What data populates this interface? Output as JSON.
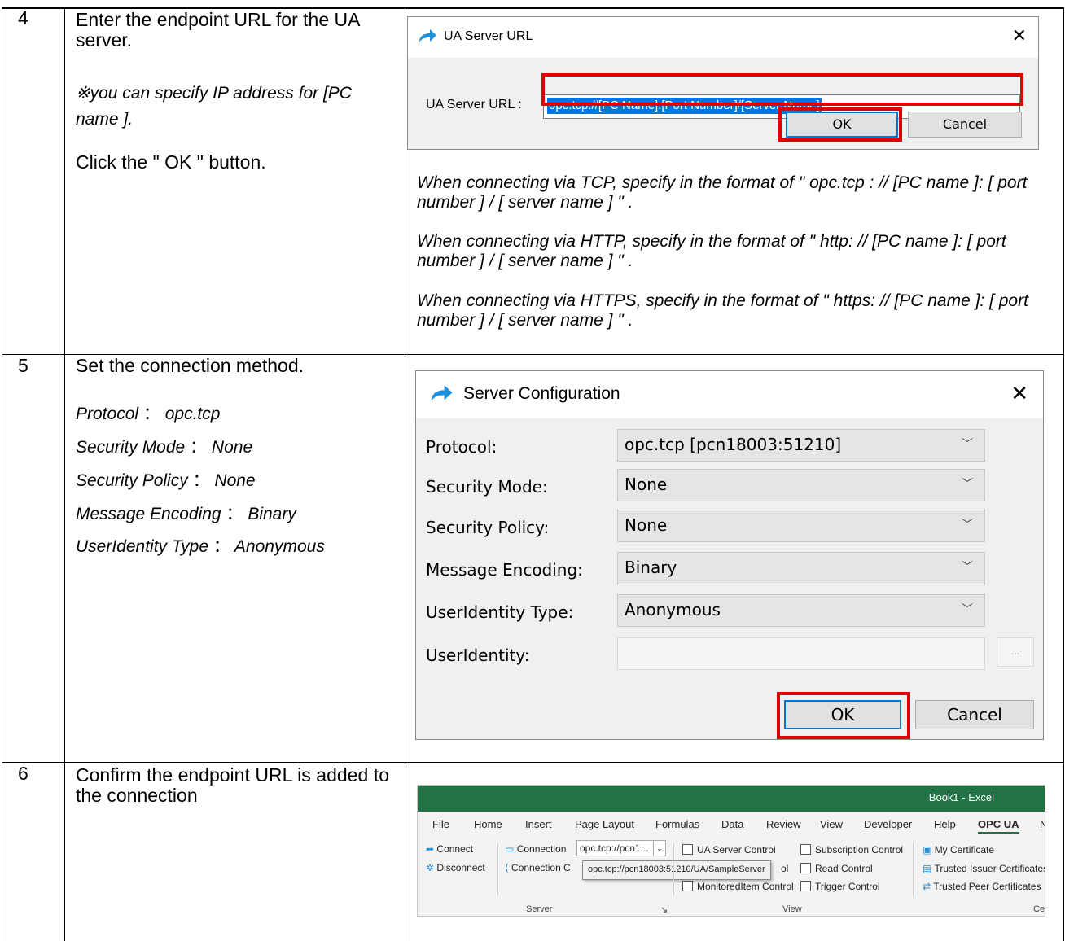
{
  "rows": [
    {
      "num": "4",
      "title": "Enter the endpoint URL for the UA server.",
      "note": "※you can specify IP address for [PC name ].",
      "action": "Click the \" OK \" button.",
      "dialog": {
        "title": "UA Server URL",
        "label": "UA Server URL :",
        "value": "opc.tcp://[PC Name]:[Port Number]/[Server Name]",
        "ok": "OK",
        "cancel": "Cancel"
      },
      "notes": [
        "When connecting via TCP, specify in the format of \" opc.tcp : // [PC name ]: [ port number ] / [ server name ] \" .",
        "When connecting via HTTP, specify in the format of \" http: // [PC name ]: [ port number ] / [ server name ] \" .",
        "When connecting via HTTPS, specify in the format of \" https: // [PC name ]: [ port number ] / [ server name ] \" ."
      ]
    },
    {
      "num": "5",
      "title": "Set the connection method.",
      "settings": [
        {
          "key": "Protocol",
          "sep": "：",
          "val": "opc.tcp"
        },
        {
          "key": "Security Mode",
          "sep": "：",
          "val": "None"
        },
        {
          "key": "Security Policy",
          "sep": "：",
          "val": "None"
        },
        {
          "key": "Message Encoding",
          "sep": "：",
          "val": "Binary"
        },
        {
          "key": "UserIdentity Type",
          "sep": "：",
          "val": "Anonymous"
        }
      ],
      "dialog": {
        "title": "Server Configuration",
        "fields": [
          {
            "label": "Protocol:",
            "value": "opc.tcp [pcn18003:51210]"
          },
          {
            "label": "Security Mode:",
            "value": "None"
          },
          {
            "label": "Security Policy:",
            "value": "None"
          },
          {
            "label": "Message Encoding:",
            "value": "Binary"
          },
          {
            "label": "UserIdentity Type:",
            "value": "Anonymous"
          },
          {
            "label": "UserIdentity:",
            "value": ""
          }
        ],
        "browse": "...",
        "ok": "OK",
        "cancel": "Cancel"
      }
    },
    {
      "num": "6",
      "title": "Confirm the endpoint URL is added to the connection",
      "excel": {
        "window_title": "Book1  -  Excel",
        "tabs": [
          "File",
          "Home",
          "Insert",
          "Page Layout",
          "Formulas",
          "Data",
          "Review",
          "View",
          "Developer",
          "Help",
          "OPC UA",
          "N"
        ],
        "connect": "Connect",
        "disconnect": "Disconnect",
        "connection": "Connection",
        "connection_c": "Connection C",
        "combo_value": "opc.tcp://pcn1...",
        "dropdown_item": "opc.tcp://pcn18003:51210/UA/SampleServer",
        "ol": "ol",
        "ua_server_control": "UA Server Control",
        "monitoreditem_control": "MonitoredItem Control",
        "subscription_control": "Subscription Control",
        "read_control": "Read Control",
        "trigger_control": "Trigger Control",
        "my_certificate": "My Certificate",
        "trusted_issuer": "Trusted Issuer Certificates",
        "trusted_peer": "Trusted Peer Certificates",
        "group_server": "Server",
        "group_view": "View",
        "group_cert": "Cert"
      }
    }
  ]
}
